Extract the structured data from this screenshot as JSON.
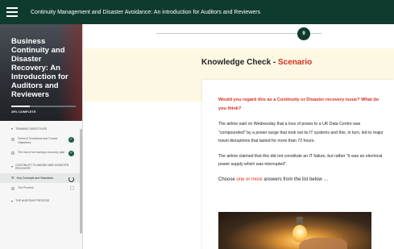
{
  "topbar": {
    "course_title": "Continuity Management and Disaster Avoidance: An introduction for Auditors and Reviewers"
  },
  "sidebar": {
    "hero_title": "Business Continuity and Disaster Recovery: An Introduction for Auditors and Reviewers",
    "progress_label": "29% COMPLETE",
    "progress_percent": 29,
    "items": [
      {
        "type": "section",
        "label": "TRAINING OBJECTIVES"
      },
      {
        "type": "lesson",
        "label": "Terms & Conditions and Course Objectives",
        "status": "complete"
      },
      {
        "type": "lesson",
        "label": "The risk of not having a recovery plan",
        "status": "complete"
      },
      {
        "type": "section",
        "label": "CONTINUITY PLANNING AND DISASTER RECOVERY"
      },
      {
        "type": "lesson",
        "label": "Key Concepts and Standards",
        "status": "in-progress",
        "active": true
      },
      {
        "type": "lesson",
        "label": "The Process",
        "status": "not-started"
      },
      {
        "type": "section",
        "label": "THE AUDITING PROCESS"
      }
    ]
  },
  "main": {
    "step_number": "9",
    "heading_prefix": "Knowledge Check - ",
    "heading_accent": "Scenario",
    "question": "Would you regard this as a Continuity or Disaster recovery issue? What do you think?",
    "paragraph_1": "The airline said on Wednesday that a loss of power to a UK Data Centre was \"compounded\" by a power surge that took out its IT systems and this, in turn, led to major travel disruptions that lasted for more than 72 hours.",
    "paragraph_2": "The airline claimed that this did not constitute an IT failure, but rather \"it was an electrical power supply which was interrupted\".",
    "choose_prefix": "Choose ",
    "choose_accent": "one or more",
    "choose_suffix": " answers from the list below …"
  },
  "colors": {
    "brand_dark_green": "#0f3b2e",
    "accent_red": "#d62f1e",
    "banner_cream": "#fdf8e4"
  }
}
